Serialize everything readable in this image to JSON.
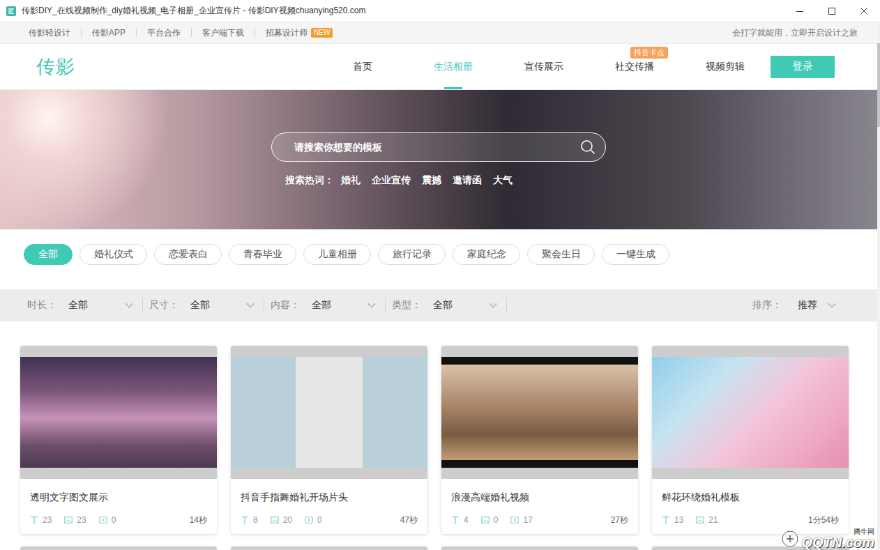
{
  "window": {
    "title": "传影DIY_在线视频制作_diy婚礼视频_电子相册_企业宣传片 - 传影DIY视频chuanying520.com"
  },
  "topbar": {
    "links": [
      {
        "label": "传影轻设计"
      },
      {
        "label": "传影APP"
      },
      {
        "label": "平台合作"
      },
      {
        "label": "客户端下载"
      },
      {
        "label": "招募设计师",
        "badge": "NEW"
      }
    ],
    "slogan": "会打字就能用，立即开启设计之旅"
  },
  "nav": {
    "logo": "传影",
    "items": [
      {
        "label": "首页",
        "selected": false
      },
      {
        "label": "生活相册",
        "selected": true
      },
      {
        "label": "宣传展示",
        "selected": false
      },
      {
        "label": "社交传播",
        "selected": false,
        "badge": "抖音卡点"
      },
      {
        "label": "视频剪辑",
        "selected": false
      }
    ],
    "login": "登录"
  },
  "hero": {
    "search": {
      "placeholder": "请搜索你想要的模板"
    },
    "hot_label": "搜索热词：",
    "hot_words": [
      "婚礼",
      "企业宣传",
      "震撼",
      "邀请函",
      "大气"
    ]
  },
  "categories": [
    {
      "label": "全部",
      "selected": true
    },
    {
      "label": "婚礼仪式",
      "selected": false
    },
    {
      "label": "恋爱表白",
      "selected": false
    },
    {
      "label": "青春毕业",
      "selected": false
    },
    {
      "label": "儿童相册",
      "selected": false
    },
    {
      "label": "旅行记录",
      "selected": false
    },
    {
      "label": "家庭纪念",
      "selected": false
    },
    {
      "label": "聚会生日",
      "selected": false
    },
    {
      "label": "一键生成",
      "selected": false
    }
  ],
  "filters": [
    {
      "label": "时长：",
      "value": "全部"
    },
    {
      "label": "尺寸：",
      "value": "全部"
    },
    {
      "label": "内容：",
      "value": "全部"
    },
    {
      "label": "类型：",
      "value": "全部"
    }
  ],
  "sort": {
    "label": "排序：",
    "value": "推荐"
  },
  "cards": [
    {
      "title": "透明文字图文展示",
      "texts": "23",
      "images": "23",
      "videos": "0",
      "duration": "14秒"
    },
    {
      "title": "抖音手指舞婚礼开场片头",
      "texts": "8",
      "images": "20",
      "videos": "0",
      "duration": "47秒"
    },
    {
      "title": "浪漫高端婚礼视频",
      "texts": "4",
      "images": "0",
      "videos": "17",
      "duration": "27秒"
    },
    {
      "title": "鲜花环绕婚礼模板",
      "texts": "13",
      "images": "21",
      "duration": "1分54秒"
    }
  ],
  "watermark": {
    "site": "腾牛网",
    "brand": "QQTN.com"
  }
}
